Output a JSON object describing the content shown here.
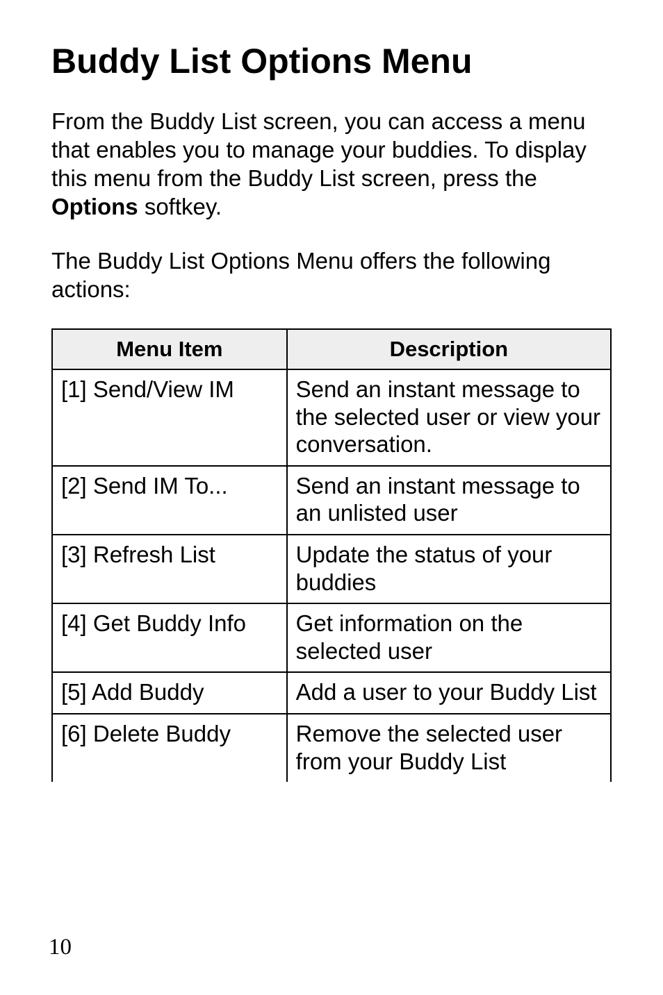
{
  "title": "Buddy List Options Menu",
  "para1_prefix": "From the Buddy List screen, you can access a menu that enables you to manage your buddies. To display this menu from the Buddy List screen, press the ",
  "para1_bold": "Options",
  "para1_suffix": " softkey.",
  "para2": "The Buddy List Options Menu offers the following actions:",
  "table": {
    "headers": {
      "item": "Menu Item",
      "desc": "Description"
    },
    "rows": [
      {
        "item": "[1] Send/View IM",
        "desc": "Send an instant message to the selected user or view your conversation."
      },
      {
        "item": "[2] Send IM To...",
        "desc": "Send an instant message to an unlisted user"
      },
      {
        "item": "[3] Refresh List",
        "desc": "Update the status of your buddies"
      },
      {
        "item": "[4] Get Buddy Info",
        "desc": "Get information on the selected user"
      },
      {
        "item": "[5] Add Buddy",
        "desc": "Add a user to your Buddy List"
      },
      {
        "item": "[6] Delete Buddy",
        "desc": "Remove the selected user from your Buddy List"
      }
    ]
  },
  "page_number": "10"
}
